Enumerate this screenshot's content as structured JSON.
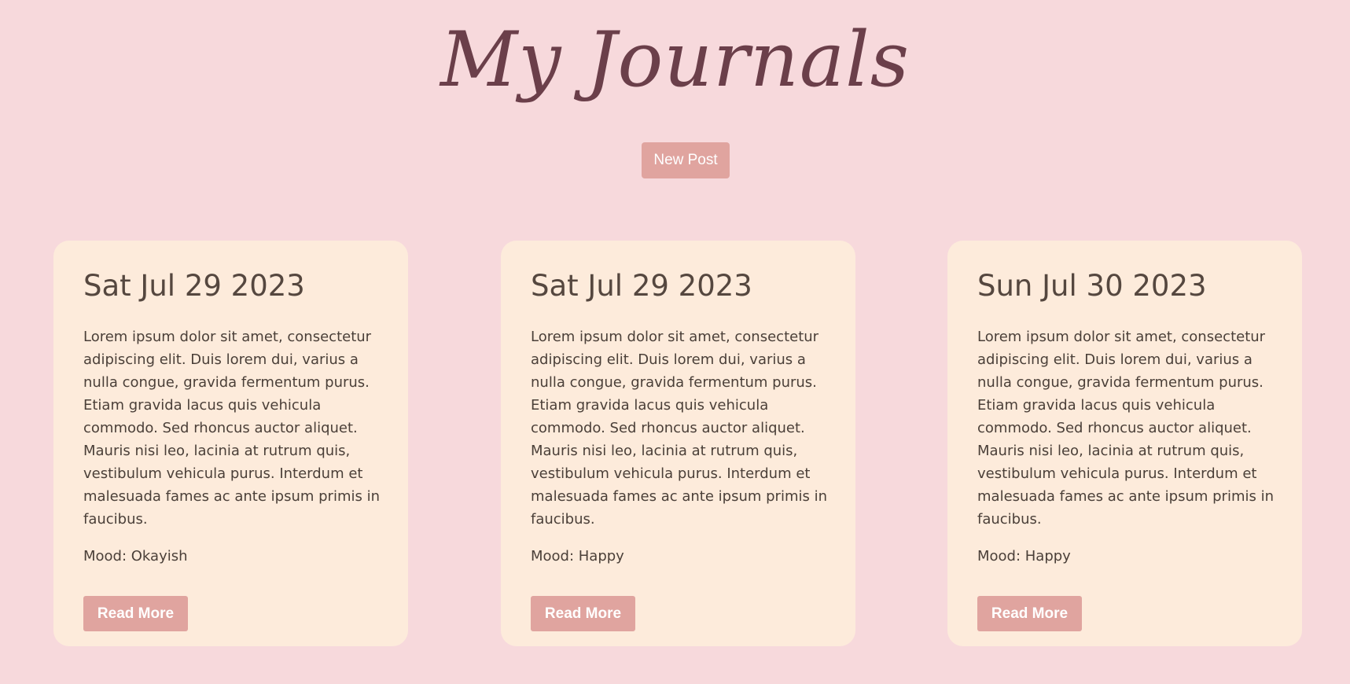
{
  "header": {
    "title": "My Journals",
    "new_post_label": "New Post"
  },
  "colors": {
    "background": "#f7d9dc",
    "card_background": "#fdebdb",
    "button": "#e0a49f",
    "title": "#6b3f4a"
  },
  "posts": [
    {
      "date": "Sat Jul 29 2023",
      "body": "Lorem ipsum dolor sit amet, consectetur adipiscing elit. Duis lorem dui, varius a nulla congue, gravida fermentum purus. Etiam gravida lacus quis vehicula commodo. Sed rhoncus auctor aliquet. Mauris nisi leo, lacinia at rutrum quis, vestibulum vehicula purus. Interdum et malesuada fames ac ante ipsum primis in faucibus.",
      "mood": "Mood: Okayish",
      "read_more_label": "Read More"
    },
    {
      "date": "Sat Jul 29 2023",
      "body": "Lorem ipsum dolor sit amet, consectetur adipiscing elit. Duis lorem dui, varius a nulla congue, gravida fermentum purus. Etiam gravida lacus quis vehicula commodo. Sed rhoncus auctor aliquet. Mauris nisi leo, lacinia at rutrum quis, vestibulum vehicula purus. Interdum et malesuada fames ac ante ipsum primis in faucibus.",
      "mood": "Mood: Happy",
      "read_more_label": "Read More"
    },
    {
      "date": "Sun Jul 30 2023",
      "body": "Lorem ipsum dolor sit amet, consectetur adipiscing elit. Duis lorem dui, varius a nulla congue, gravida fermentum purus. Etiam gravida lacus quis vehicula commodo. Sed rhoncus auctor aliquet. Mauris nisi leo, lacinia at rutrum quis, vestibulum vehicula purus. Interdum et malesuada fames ac ante ipsum primis in faucibus.",
      "mood": "Mood: Happy",
      "read_more_label": "Read More"
    }
  ]
}
